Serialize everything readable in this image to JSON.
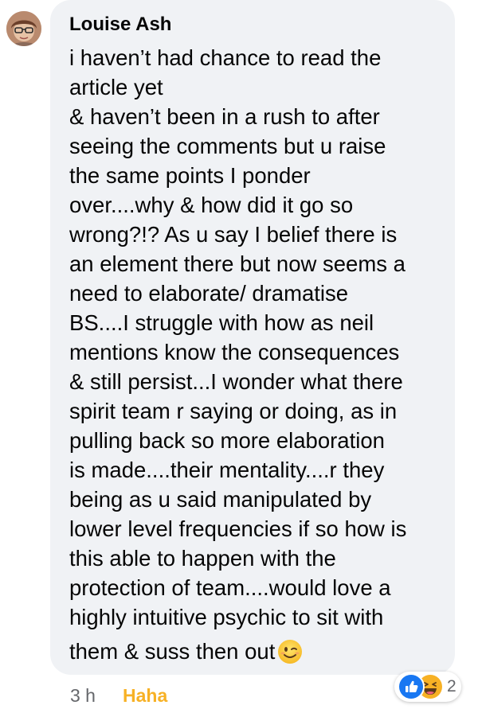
{
  "comment": {
    "author": "Louise Ash",
    "lines": [
      "i haven’t had chance to read the",
      "article yet",
      "& haven’t been in a rush to after",
      "seeing the comments but u raise",
      "the same points I ponder",
      "over....why & how did it go so",
      "wrong?!? As u say I belief there is",
      "an element there but now seems a",
      "need to elaborate/ dramatise",
      "BS....I struggle with how as neil",
      "mentions know the consequences",
      "& still persist...I wonder what there",
      "spirit team r saying or doing, as in",
      "pulling back so more elaboration",
      "is made....their mentality....r they",
      "being as u said manipulated by",
      "lower level frequencies if so how is",
      "this able to happen with the",
      "protection of team....would love a",
      "highly intuitive psychic to sit with"
    ],
    "last_line": "them & suss then out",
    "trailing_emoji": "wink-emoji"
  },
  "meta": {
    "timestamp": "3 h",
    "reaction_action": "Haha",
    "reaction_action_color": "#f7b125"
  },
  "reactions": {
    "icons": [
      "like-icon",
      "haha-icon"
    ],
    "count": "2",
    "like_color": "#1877f2",
    "haha_color": "#f7b125"
  },
  "colors": {
    "bubble": "#f0f2f5",
    "text": "#050505",
    "secondary": "#65676b"
  }
}
